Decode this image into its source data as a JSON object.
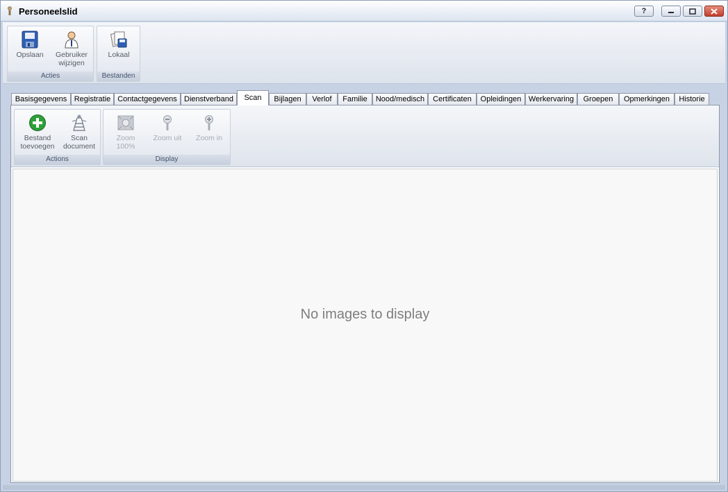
{
  "window": {
    "title": "Personeelslid",
    "buttons": {
      "help": "?",
      "minimize": "–",
      "maximize": "□",
      "close": "✕"
    }
  },
  "ribbon": {
    "groups": [
      {
        "label": "Acties",
        "buttons": [
          {
            "label": "Opslaan",
            "icon": "save-icon"
          },
          {
            "label": "Gebruiker wijzigen",
            "icon": "user-icon"
          }
        ]
      },
      {
        "label": "Bestanden",
        "buttons": [
          {
            "label": "Lokaal",
            "icon": "local-files-icon"
          }
        ]
      }
    ]
  },
  "tabs": [
    "Basisgegevens",
    "Registratie",
    "Contactgegevens",
    "Dienstverband",
    "Scan",
    "Bijlagen",
    "Verlof",
    "Familie",
    "Nood/medisch",
    "Certificaten",
    "Opleidingen",
    "Werkervaring",
    "Groepen",
    "Opmerkingen",
    "Historie"
  ],
  "active_tab": "Scan",
  "scan_ribbon": {
    "groups": [
      {
        "label": "Actions",
        "buttons": [
          {
            "label": "Bestand toevoegen",
            "icon": "add-icon",
            "enabled": true
          },
          {
            "label": "Scan document",
            "icon": "scanner-icon",
            "enabled": true
          }
        ]
      },
      {
        "label": "Display",
        "buttons": [
          {
            "label": "Zoom 100%",
            "icon": "zoom-100-icon",
            "enabled": false
          },
          {
            "label": "Zoom uit",
            "icon": "zoom-out-icon",
            "enabled": false
          },
          {
            "label": "Zoom in",
            "icon": "zoom-in-icon",
            "enabled": false
          }
        ]
      }
    ]
  },
  "viewer": {
    "empty_message": "No images to display"
  }
}
